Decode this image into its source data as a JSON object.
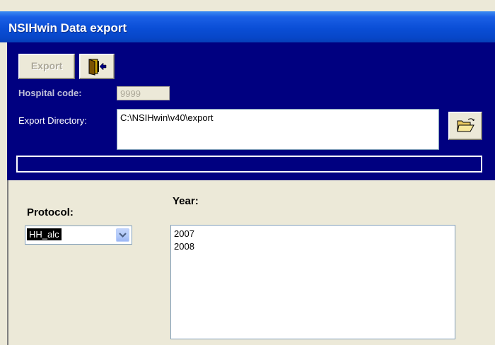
{
  "window": {
    "title": "NSIHwin Data export"
  },
  "toolbar": {
    "export_label": "Export"
  },
  "hospital": {
    "label": "Hospital code:",
    "value": "9999"
  },
  "export_dir": {
    "label": "Export Directory:",
    "value": "C:\\NSIHwin\\v40\\export"
  },
  "protocol": {
    "label": "Protocol:",
    "selected": "HH_alc"
  },
  "year": {
    "label": "Year:",
    "items": [
      "2007",
      "2008"
    ]
  },
  "icons": {
    "exit": "exit-door-icon",
    "folder": "open-folder-icon",
    "dropdown": "chevron-down-icon"
  },
  "colors": {
    "panel": "#000080",
    "titlebar": "#0a4ed6",
    "window_bg": "#ece9d8",
    "dropdown_arrow": "#4d6185"
  }
}
